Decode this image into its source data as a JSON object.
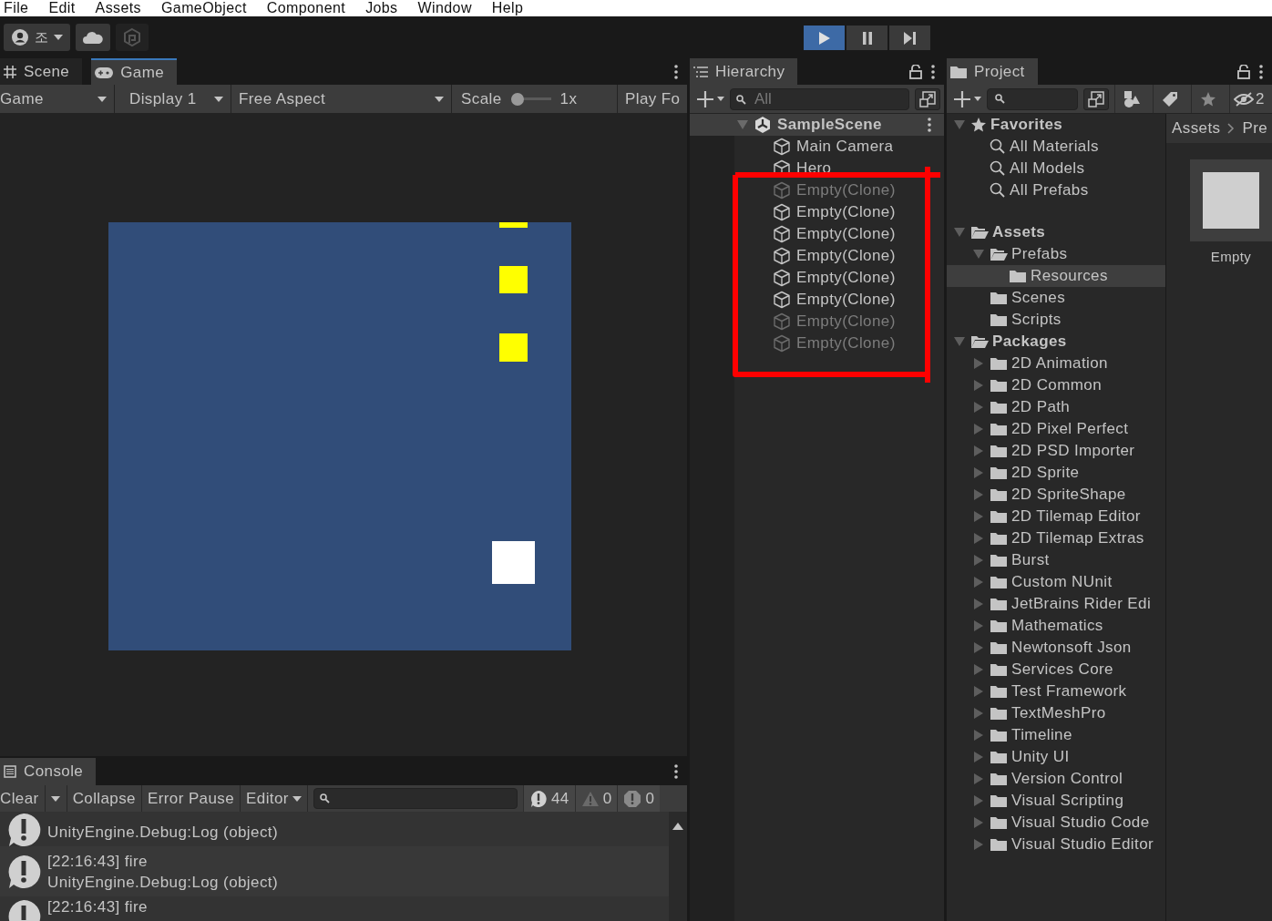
{
  "menu": [
    "File",
    "Edit",
    "Assets",
    "GameObject",
    "Component",
    "Jobs",
    "Window",
    "Help"
  ],
  "toolbar": {
    "account_label": "조",
    "play_controls": [
      {
        "kind": "play",
        "selected": true
      },
      {
        "kind": "pause",
        "selected": false
      },
      {
        "kind": "step",
        "selected": false
      }
    ]
  },
  "game_panel": {
    "tabs": [
      {
        "label": "Scene",
        "kind": "scene",
        "selected": false
      },
      {
        "label": "Game",
        "kind": "game",
        "selected": true
      }
    ],
    "toolbar": {
      "mode": "Game",
      "display": "Display 1",
      "aspect": "Free Aspect",
      "scale_label": "Scale",
      "scale": {
        "level": 0
      },
      "scale_reading": "1x",
      "play_focus": "Play Fo"
    }
  },
  "console": {
    "tab": "Console",
    "buttons": [
      {
        "label": "Clear",
        "kind": "split"
      },
      {
        "label": "Collapse",
        "kind": "toggle"
      },
      {
        "label": "Error Pause",
        "kind": "toggle"
      },
      {
        "label": "Editor",
        "kind": "dropdown"
      }
    ],
    "counts": [
      {
        "kind": "info",
        "count": "44"
      },
      {
        "kind": "warning",
        "count": "0"
      },
      {
        "kind": "error",
        "count": "0"
      }
    ],
    "entries": [
      {
        "lines": [
          "UnityEngine.Debug:Log (object)"
        ]
      },
      {
        "lines": [
          "[22:16:43] fire",
          "UnityEngine.Debug:Log (object)"
        ]
      },
      {
        "lines": [
          "[22:16:43] fire"
        ]
      }
    ]
  },
  "hierarchy": {
    "tab": "Hierarchy",
    "search_placeholder": "All",
    "scene": {
      "name": "SampleScene",
      "expanded": true
    },
    "objects": [
      {
        "name": "Main Camera",
        "active": true
      },
      {
        "name": "Hero",
        "active": true
      },
      {
        "name": "Empty(Clone)",
        "active": false
      },
      {
        "name": "Empty(Clone)",
        "active": true
      },
      {
        "name": "Empty(Clone)",
        "active": true
      },
      {
        "name": "Empty(Clone)",
        "active": true
      },
      {
        "name": "Empty(Clone)",
        "active": true
      },
      {
        "name": "Empty(Clone)",
        "active": true
      },
      {
        "name": "Empty(Clone)",
        "active": false
      },
      {
        "name": "Empty(Clone)",
        "active": false
      }
    ]
  },
  "project": {
    "tab": "Project",
    "hidden_count": "2",
    "tree": [
      {
        "name": "Favorites",
        "kind": "favorites",
        "expanded": true,
        "selected": false,
        "children": [
          {
            "name": "All Materials",
            "kind": "search",
            "selected": false
          },
          {
            "name": "All Models",
            "kind": "search",
            "selected": false
          },
          {
            "name": "All Prefabs",
            "kind": "search",
            "selected": false
          }
        ]
      },
      {
        "name": "Assets",
        "kind": "folder",
        "expanded": true,
        "selected": false,
        "children": [
          {
            "name": "Prefabs",
            "kind": "folder",
            "expanded": true,
            "selected": false,
            "children": [
              {
                "name": "Resources",
                "kind": "folder",
                "selected": true
              }
            ]
          },
          {
            "name": "Scenes",
            "kind": "folder",
            "selected": false
          },
          {
            "name": "Scripts",
            "kind": "folder",
            "selected": false
          }
        ]
      },
      {
        "name": "Packages",
        "kind": "folder",
        "expanded": true,
        "selected": false,
        "children": [
          {
            "name": "2D Animation",
            "kind": "folder",
            "expanded": false,
            "selected": false
          },
          {
            "name": "2D Common",
            "kind": "folder",
            "expanded": false,
            "selected": false
          },
          {
            "name": "2D Path",
            "kind": "folder",
            "expanded": false,
            "selected": false
          },
          {
            "name": "2D Pixel Perfect",
            "kind": "folder",
            "expanded": false,
            "selected": false
          },
          {
            "name": "2D PSD Importer",
            "kind": "folder",
            "expanded": false,
            "selected": false
          },
          {
            "name": "2D Sprite",
            "kind": "folder",
            "expanded": false,
            "selected": false
          },
          {
            "name": "2D SpriteShape",
            "kind": "folder",
            "expanded": false,
            "selected": false
          },
          {
            "name": "2D Tilemap Editor",
            "kind": "folder",
            "expanded": false,
            "selected": false
          },
          {
            "name": "2D Tilemap Extras",
            "kind": "folder",
            "expanded": false,
            "selected": false
          },
          {
            "name": "Burst",
            "kind": "folder",
            "expanded": false,
            "selected": false
          },
          {
            "name": "Custom NUnit",
            "kind": "folder",
            "expanded": false,
            "selected": false
          },
          {
            "name": "JetBrains Rider Edi",
            "kind": "folder",
            "expanded": false,
            "selected": false
          },
          {
            "name": "Mathematics",
            "kind": "folder",
            "expanded": false,
            "selected": false
          },
          {
            "name": "Newtonsoft Json",
            "kind": "folder",
            "expanded": false,
            "selected": false
          },
          {
            "name": "Services Core",
            "kind": "folder",
            "expanded": false,
            "selected": false
          },
          {
            "name": "Test Framework",
            "kind": "folder",
            "expanded": false,
            "selected": false
          },
          {
            "name": "TextMeshPro",
            "kind": "folder",
            "expanded": false,
            "selected": false
          },
          {
            "name": "Timeline",
            "kind": "folder",
            "expanded": false,
            "selected": false
          },
          {
            "name": "Unity UI",
            "kind": "folder",
            "expanded": false,
            "selected": false
          },
          {
            "name": "Version Control",
            "kind": "folder",
            "expanded": false,
            "selected": false
          },
          {
            "name": "Visual Scripting",
            "kind": "folder",
            "expanded": false,
            "selected": false
          },
          {
            "name": "Visual Studio Code",
            "kind": "folder",
            "expanded": false,
            "selected": false
          },
          {
            "name": "Visual Studio Editor",
            "kind": "folder",
            "expanded": false,
            "selected": false
          }
        ]
      }
    ],
    "breadcrumb": [
      "Assets",
      "Pre"
    ],
    "assets": [
      {
        "name": "Empty"
      }
    ]
  }
}
